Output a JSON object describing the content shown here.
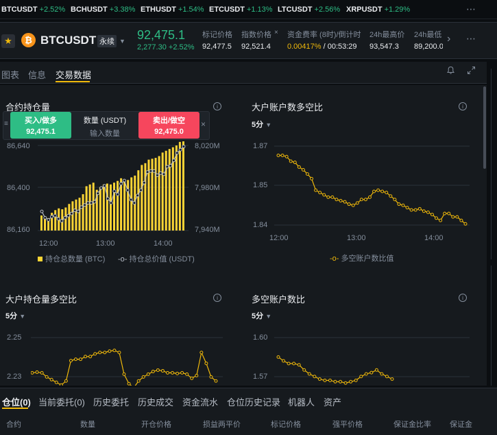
{
  "ticker": [
    {
      "symbol": "BTCUSDT",
      "change": "+2.52%"
    },
    {
      "symbol": "BCHUSDT",
      "change": "+3.38%"
    },
    {
      "symbol": "ETHUSDT",
      "change": "+1.54%"
    },
    {
      "symbol": "ETCUSDT",
      "change": "+1.13%"
    },
    {
      "symbol": "LTCUSDT",
      "change": "+2.56%"
    },
    {
      "symbol": "XRPUSDT",
      "change": "+1.29%"
    }
  ],
  "header": {
    "symbol": "BTCUSDT",
    "contract_type": "永续",
    "last_price": "92,475.1",
    "change_abs": "2,277.30",
    "change_pct": "+2.52%",
    "stats": [
      {
        "label": "标记价格",
        "value": "92,477.5"
      },
      {
        "label": "指数价格",
        "value": "92,521.4"
      },
      {
        "label": "资金费率 (8时)/倒计时",
        "value_rate": "0.00417%",
        "value_countdown": "/ 00:53:29"
      },
      {
        "label": "24h最高价",
        "value": "93,547.3"
      },
      {
        "label": "24h最低",
        "value": "89,200.0"
      }
    ]
  },
  "nav_tabs": [
    "图表",
    "信息",
    "交易数据"
  ],
  "order_widget": {
    "buy_label": "买入/做多",
    "buy_price": "92,475.1",
    "qty_label": "数量 (USDT)",
    "qty_placeholder": "输入数量",
    "sell_label": "卖出/做空",
    "sell_price": "92,475.0"
  },
  "panels": {
    "oi": {
      "title": "合约持仓量",
      "legend_bar": "持仓总数量 (BTC)",
      "legend_line": "持仓总价值 (USDT)"
    },
    "top_acct": {
      "title": "大户账户数多空比",
      "period": "5分",
      "legend": "多空账户数比值"
    },
    "top_pos": {
      "title": "大户持仓量多空比",
      "period": "5分"
    },
    "global_acct": {
      "title": "多空账户数比",
      "period": "5分"
    }
  },
  "chart_data": [
    {
      "type": "bar",
      "title": "合约持仓量",
      "x_ticks": [
        "12:00",
        "13:00",
        "14:00"
      ],
      "y_left_ticks": [
        "86,640",
        "86,400",
        "86,160"
      ],
      "y_left_range": [
        86160,
        86640
      ],
      "y_right_ticks": [
        "8,020M",
        "7,980M",
        "7,940M"
      ],
      "y_right_range": [
        7940,
        8020
      ],
      "series": [
        {
          "name": "持仓总数量 (BTC)",
          "values": [
            86245,
            86240,
            86230,
            86260,
            86275,
            86285,
            86280,
            86290,
            86310,
            86325,
            86335,
            86345,
            86365,
            86410,
            86420,
            86430,
            86390,
            86405,
            86420,
            86425,
            86420,
            86430,
            86440,
            86455,
            86450,
            86445,
            86460,
            86470,
            86500,
            86530,
            86540,
            86560,
            86565,
            86570,
            86580,
            86600,
            86610,
            86620,
            86630,
            86640,
            86660,
            86680
          ]
        },
        {
          "name": "持仓总价值 (USDT)",
          "values": [
            7958,
            7952,
            7950,
            7953,
            7954,
            7951,
            7949,
            7952,
            7954,
            7956,
            7959,
            7958,
            7962,
            7964,
            7966,
            7966,
            7967,
            7975,
            7980,
            7982,
            7970,
            7966,
            7977,
            7974,
            7984,
            7987,
            7978,
            7969,
            7966,
            7973,
            7978,
            7985,
            7995,
            7996,
            7996,
            7992,
            7994,
            7993,
            8000,
            8001,
            8006,
            8013,
            8016,
            8019
          ]
        }
      ]
    },
    {
      "type": "line",
      "title": "大户账户数多空比",
      "x_ticks": [
        "12:00",
        "13:00",
        "14:00"
      ],
      "y_ticks": [
        "1.87",
        "1.85",
        "1.84"
      ],
      "ylim": [
        1.84,
        1.874
      ],
      "series": [
        {
          "name": "多空账户数比值",
          "values": [
            1.87,
            1.87,
            1.8695,
            1.8675,
            1.867,
            1.865,
            1.8638,
            1.862,
            1.86,
            1.855,
            1.854,
            1.853,
            1.852,
            1.852,
            1.851,
            1.8505,
            1.85,
            1.849,
            1.8485,
            1.8495,
            1.851,
            1.851,
            1.852,
            1.8545,
            1.855,
            1.8545,
            1.854,
            1.8525,
            1.851,
            1.849,
            1.8485,
            1.8475,
            1.8465,
            1.8465,
            1.847,
            1.846,
            1.8455,
            1.8445,
            1.843,
            1.842,
            1.845,
            1.845,
            1.8435,
            1.8435,
            1.842,
            1.8405
          ]
        }
      ]
    },
    {
      "type": "line",
      "title": "大户持仓量多空比",
      "y_ticks": [
        "2.25",
        "2.23"
      ],
      "ylim": [
        2.218,
        2.262
      ],
      "series": [
        {
          "values": [
            2.236,
            2.2365,
            2.236,
            2.233,
            2.231,
            2.229,
            2.227,
            2.23,
            2.245,
            2.246,
            2.246,
            2.248,
            2.248,
            2.25,
            2.251,
            2.251,
            2.252,
            2.2525,
            2.251,
            2.235,
            2.228,
            2.225,
            2.23,
            2.233,
            2.235,
            2.237,
            2.238,
            2.2375,
            2.236,
            2.236,
            2.2355,
            2.236,
            2.235,
            2.232,
            2.234,
            2.251,
            2.243,
            2.233,
            2.23
          ]
        }
      ]
    },
    {
      "type": "line",
      "title": "多空账户数比",
      "y_ticks": [
        "1.60",
        "1.57"
      ],
      "ylim": [
        1.56,
        1.606
      ],
      "series": [
        {
          "values": [
            1.591,
            1.588,
            1.586,
            1.586,
            1.585,
            1.581,
            1.578,
            1.576,
            1.574,
            1.573,
            1.573,
            1.572,
            1.572,
            1.571,
            1.572,
            1.573,
            1.576,
            1.578,
            1.579,
            1.581,
            1.578,
            1.576,
            1.574
          ]
        }
      ]
    }
  ],
  "bottom_tabs": [
    "仓位(0)",
    "当前委托(0)",
    "历史委托",
    "历史成交",
    "资金流水",
    "仓位历史记录",
    "机器人",
    "资产"
  ],
  "columns": [
    "合约",
    "数量",
    "开仓价格",
    "损益两平价",
    "标记价格",
    "强平价格",
    "保证金比率",
    "保证金"
  ],
  "colors": {
    "green": "#2ebd85",
    "red": "#f6465d",
    "yellow": "#f0b90b",
    "bar": "#fcd535"
  }
}
